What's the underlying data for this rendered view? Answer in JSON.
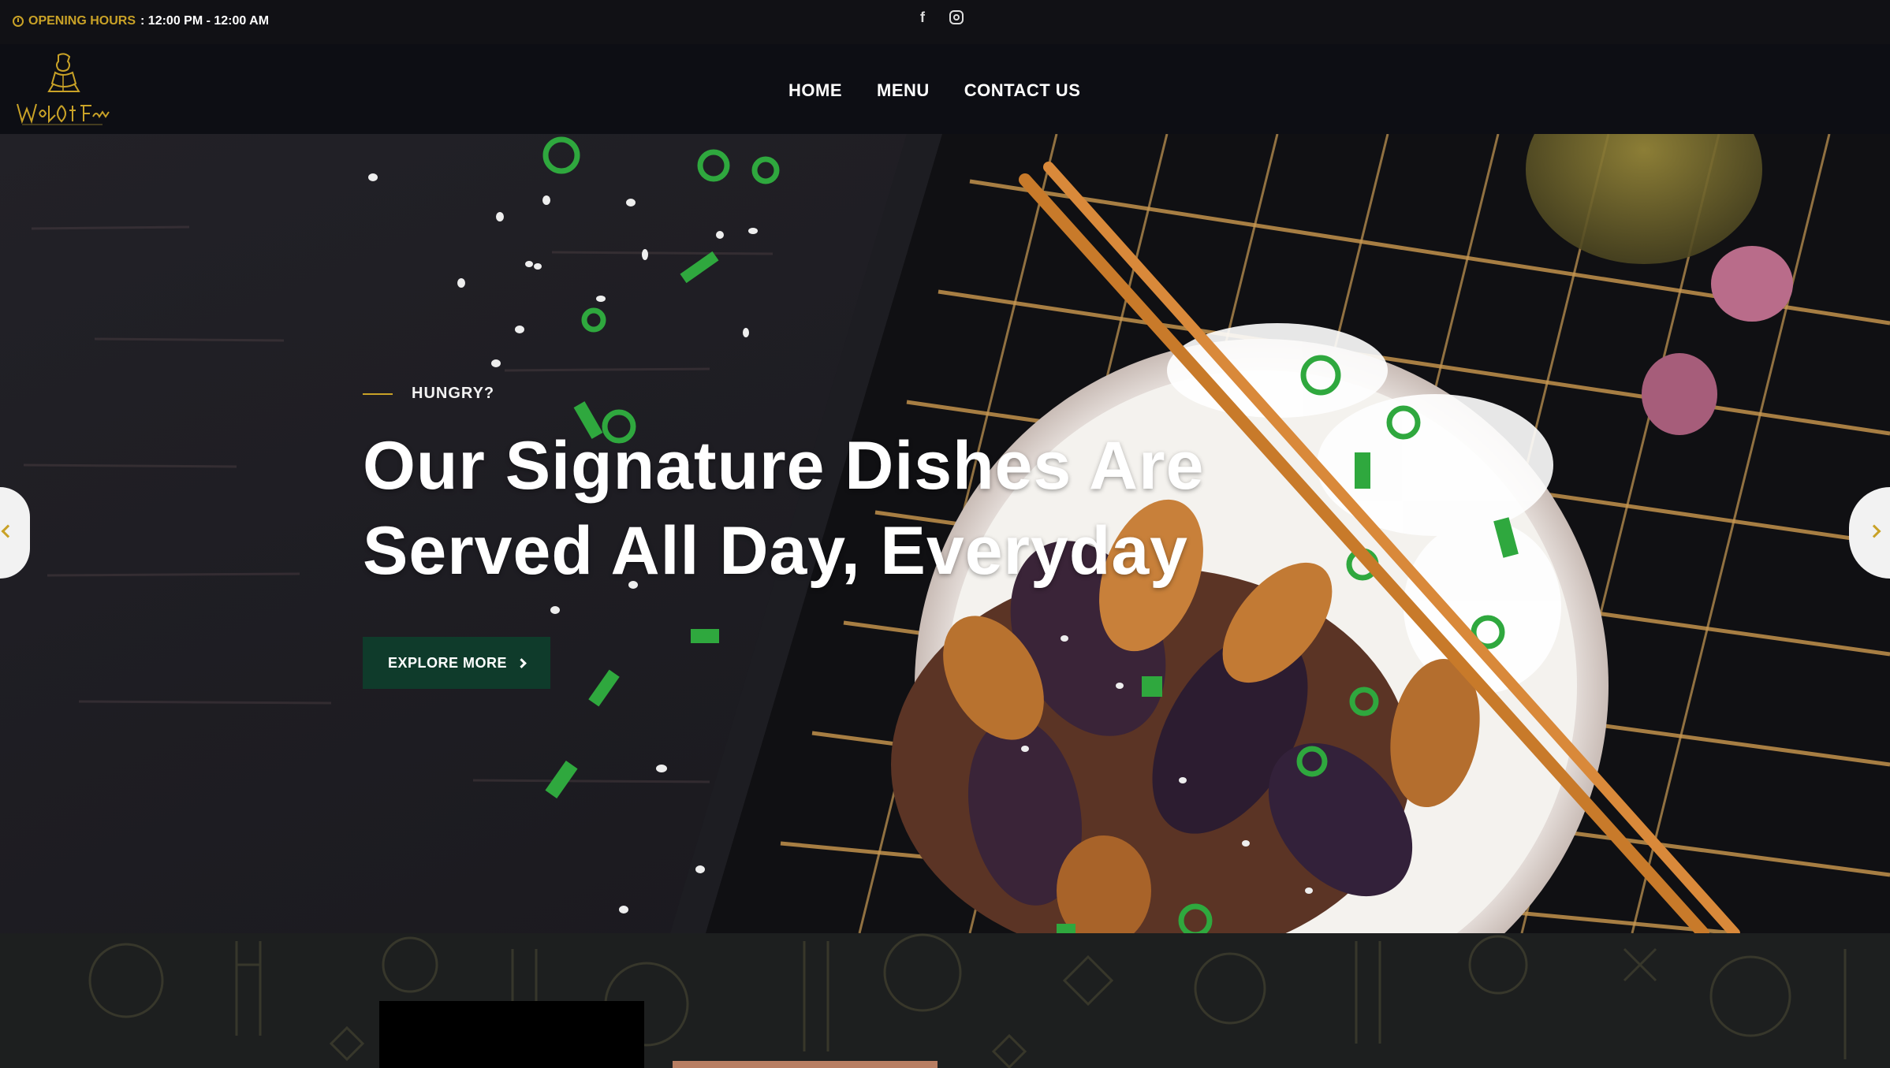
{
  "topbar": {
    "hours_label": "OPENING HOURS",
    "hours_value": ": 12:00 PM - 12:00 AM",
    "socials": [
      "facebook-icon",
      "instagram-icon"
    ]
  },
  "brand": {
    "logo_text": "Wok Of Fame"
  },
  "nav": {
    "items": [
      "HOME",
      "MENU",
      "CONTACT US"
    ]
  },
  "hero": {
    "eyebrow": "HUNGRY?",
    "headline_line1": "Our Signature Dishes Are",
    "headline_line2": "Served All Day, Everyday",
    "cta_label": "EXPLORE MORE"
  },
  "colors": {
    "accent": "#c9a227",
    "cta_bg": "#0f3b2b",
    "topbar_bg": "#111115",
    "hero_bg": "#1c1b21"
  }
}
